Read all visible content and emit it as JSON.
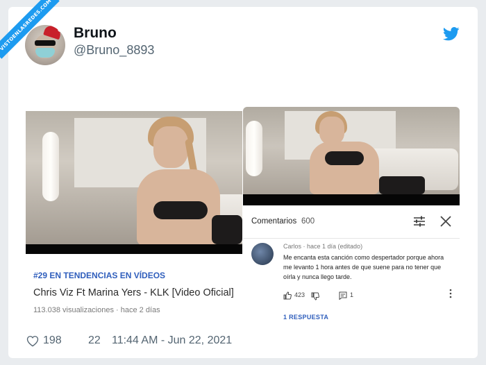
{
  "watermark": "VISTOENLASREDES.COM",
  "tweet": {
    "author_name": "Bruno",
    "author_handle": "@Bruno_8893",
    "likes": "198",
    "replies": "22",
    "timestamp": "11:44 AM - Jun 22, 2021"
  },
  "screenshot_left": {
    "trending": "#29 EN TENDENCIAS EN VÍDEOS",
    "video_title": "Chris Viz Ft Marina Yers - KLK  [Video Oficial]",
    "video_meta": "113.038 visualizaciones · hace 2 días"
  },
  "screenshot_right": {
    "comments_label": "Comentarios",
    "comments_count": "600",
    "comment": {
      "meta": "Carlos · hace 1 día (editado)",
      "text": "Me encanta esta canción como despertador porque ahora me levanto 1 hora antes de que suene para no tener que oírla y nunca llego tarde.",
      "likes": "423",
      "reply_count": "1",
      "replies_link": "1 RESPUESTA"
    }
  },
  "colors": {
    "twitter_blue": "#1d9bf0",
    "link_blue": "#2f5ebc",
    "muted": "#536471"
  }
}
